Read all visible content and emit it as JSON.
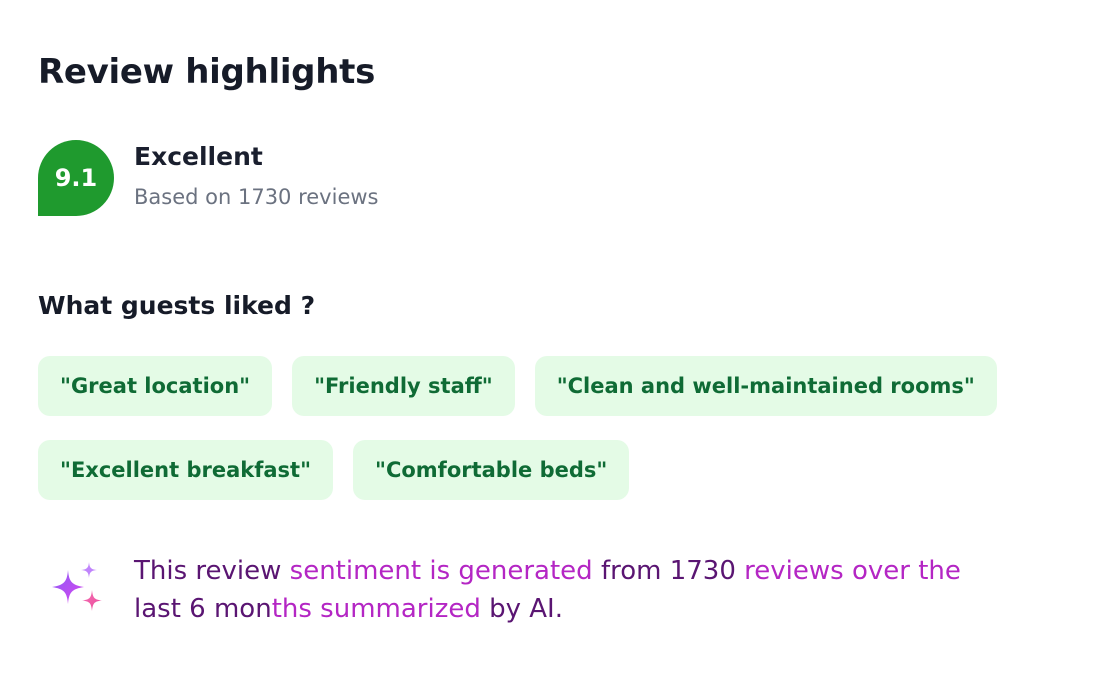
{
  "header": {
    "title": "Review highlights"
  },
  "rating": {
    "score": "9.1",
    "label": "Excellent",
    "subtitle": "Based on 1730 reviews",
    "badge_color": "#1f9a2e"
  },
  "liked": {
    "heading": "What guests liked ?",
    "chips": [
      "\"Great location\"",
      "\"Friendly staff\"",
      "\"Clean and well-maintained rooms\"",
      "\"Excellent breakfast\"",
      "\"Comfortable beds\""
    ],
    "chip_bg": "#e4fbe6",
    "chip_text_color": "#0f6b35"
  },
  "ai_summary": {
    "icon": "sparkles-icon",
    "parts": [
      "This review ",
      "sentiment is generated",
      " from 1730 ",
      "reviews over the",
      " last 6 mon",
      "ths summarized",
      " by AI."
    ],
    "colors": {
      "dark": "#5a1572",
      "highlight": "#b426c4"
    }
  }
}
